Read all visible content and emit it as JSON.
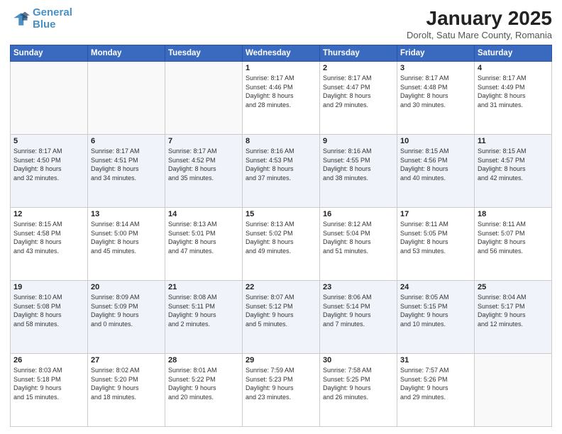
{
  "logo": {
    "line1": "General",
    "line2": "Blue"
  },
  "title": "January 2025",
  "subtitle": "Dorolt, Satu Mare County, Romania",
  "days_of_week": [
    "Sunday",
    "Monday",
    "Tuesday",
    "Wednesday",
    "Thursday",
    "Friday",
    "Saturday"
  ],
  "weeks": [
    [
      {
        "day": "",
        "info": ""
      },
      {
        "day": "",
        "info": ""
      },
      {
        "day": "",
        "info": ""
      },
      {
        "day": "1",
        "info": "Sunrise: 8:17 AM\nSunset: 4:46 PM\nDaylight: 8 hours\nand 28 minutes."
      },
      {
        "day": "2",
        "info": "Sunrise: 8:17 AM\nSunset: 4:47 PM\nDaylight: 8 hours\nand 29 minutes."
      },
      {
        "day": "3",
        "info": "Sunrise: 8:17 AM\nSunset: 4:48 PM\nDaylight: 8 hours\nand 30 minutes."
      },
      {
        "day": "4",
        "info": "Sunrise: 8:17 AM\nSunset: 4:49 PM\nDaylight: 8 hours\nand 31 minutes."
      }
    ],
    [
      {
        "day": "5",
        "info": "Sunrise: 8:17 AM\nSunset: 4:50 PM\nDaylight: 8 hours\nand 32 minutes."
      },
      {
        "day": "6",
        "info": "Sunrise: 8:17 AM\nSunset: 4:51 PM\nDaylight: 8 hours\nand 34 minutes."
      },
      {
        "day": "7",
        "info": "Sunrise: 8:17 AM\nSunset: 4:52 PM\nDaylight: 8 hours\nand 35 minutes."
      },
      {
        "day": "8",
        "info": "Sunrise: 8:16 AM\nSunset: 4:53 PM\nDaylight: 8 hours\nand 37 minutes."
      },
      {
        "day": "9",
        "info": "Sunrise: 8:16 AM\nSunset: 4:55 PM\nDaylight: 8 hours\nand 38 minutes."
      },
      {
        "day": "10",
        "info": "Sunrise: 8:15 AM\nSunset: 4:56 PM\nDaylight: 8 hours\nand 40 minutes."
      },
      {
        "day": "11",
        "info": "Sunrise: 8:15 AM\nSunset: 4:57 PM\nDaylight: 8 hours\nand 42 minutes."
      }
    ],
    [
      {
        "day": "12",
        "info": "Sunrise: 8:15 AM\nSunset: 4:58 PM\nDaylight: 8 hours\nand 43 minutes."
      },
      {
        "day": "13",
        "info": "Sunrise: 8:14 AM\nSunset: 5:00 PM\nDaylight: 8 hours\nand 45 minutes."
      },
      {
        "day": "14",
        "info": "Sunrise: 8:13 AM\nSunset: 5:01 PM\nDaylight: 8 hours\nand 47 minutes."
      },
      {
        "day": "15",
        "info": "Sunrise: 8:13 AM\nSunset: 5:02 PM\nDaylight: 8 hours\nand 49 minutes."
      },
      {
        "day": "16",
        "info": "Sunrise: 8:12 AM\nSunset: 5:04 PM\nDaylight: 8 hours\nand 51 minutes."
      },
      {
        "day": "17",
        "info": "Sunrise: 8:11 AM\nSunset: 5:05 PM\nDaylight: 8 hours\nand 53 minutes."
      },
      {
        "day": "18",
        "info": "Sunrise: 8:11 AM\nSunset: 5:07 PM\nDaylight: 8 hours\nand 56 minutes."
      }
    ],
    [
      {
        "day": "19",
        "info": "Sunrise: 8:10 AM\nSunset: 5:08 PM\nDaylight: 8 hours\nand 58 minutes."
      },
      {
        "day": "20",
        "info": "Sunrise: 8:09 AM\nSunset: 5:09 PM\nDaylight: 9 hours\nand 0 minutes."
      },
      {
        "day": "21",
        "info": "Sunrise: 8:08 AM\nSunset: 5:11 PM\nDaylight: 9 hours\nand 2 minutes."
      },
      {
        "day": "22",
        "info": "Sunrise: 8:07 AM\nSunset: 5:12 PM\nDaylight: 9 hours\nand 5 minutes."
      },
      {
        "day": "23",
        "info": "Sunrise: 8:06 AM\nSunset: 5:14 PM\nDaylight: 9 hours\nand 7 minutes."
      },
      {
        "day": "24",
        "info": "Sunrise: 8:05 AM\nSunset: 5:15 PM\nDaylight: 9 hours\nand 10 minutes."
      },
      {
        "day": "25",
        "info": "Sunrise: 8:04 AM\nSunset: 5:17 PM\nDaylight: 9 hours\nand 12 minutes."
      }
    ],
    [
      {
        "day": "26",
        "info": "Sunrise: 8:03 AM\nSunset: 5:18 PM\nDaylight: 9 hours\nand 15 minutes."
      },
      {
        "day": "27",
        "info": "Sunrise: 8:02 AM\nSunset: 5:20 PM\nDaylight: 9 hours\nand 18 minutes."
      },
      {
        "day": "28",
        "info": "Sunrise: 8:01 AM\nSunset: 5:22 PM\nDaylight: 9 hours\nand 20 minutes."
      },
      {
        "day": "29",
        "info": "Sunrise: 7:59 AM\nSunset: 5:23 PM\nDaylight: 9 hours\nand 23 minutes."
      },
      {
        "day": "30",
        "info": "Sunrise: 7:58 AM\nSunset: 5:25 PM\nDaylight: 9 hours\nand 26 minutes."
      },
      {
        "day": "31",
        "info": "Sunrise: 7:57 AM\nSunset: 5:26 PM\nDaylight: 9 hours\nand 29 minutes."
      },
      {
        "day": "",
        "info": ""
      }
    ]
  ]
}
